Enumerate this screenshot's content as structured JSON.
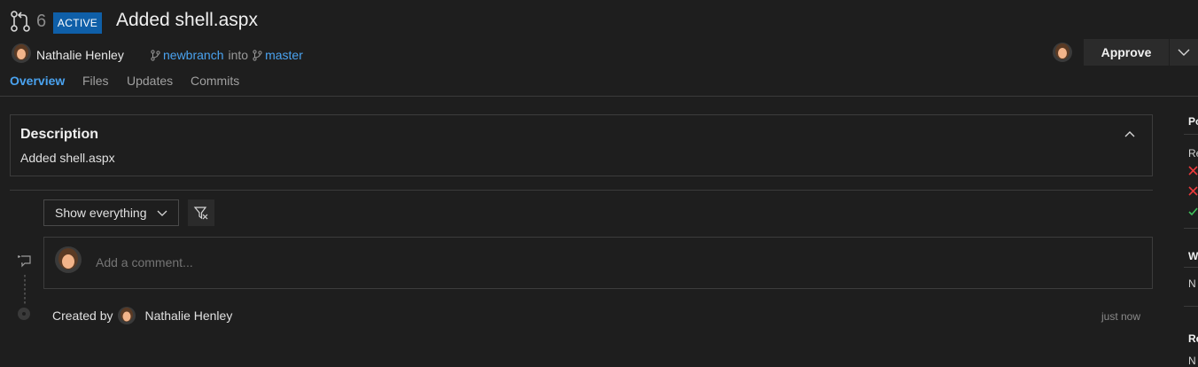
{
  "pr": {
    "id": "6",
    "status": "ACTIVE",
    "title": "Added shell.aspx",
    "author": "Nathalie Henley",
    "source_branch": "newbranch",
    "into_text": "into",
    "target_branch": "master"
  },
  "actions": {
    "approve_label": "Approve"
  },
  "tabs": [
    {
      "label": "Overview",
      "active": true
    },
    {
      "label": "Files",
      "active": false
    },
    {
      "label": "Updates",
      "active": false
    },
    {
      "label": "Commits",
      "active": false
    }
  ],
  "description": {
    "heading": "Description",
    "text": "Added shell.aspx"
  },
  "filter": {
    "selected": "Show everything"
  },
  "comment": {
    "placeholder": "Add a comment..."
  },
  "timeline": {
    "created_by_text": "Created by",
    "created_by_name": "Nathalie Henley",
    "time": "just now"
  },
  "sidebar": {
    "section1_label": "Po",
    "reviewers_label": "Re",
    "section2_label": "W",
    "section2_value": "N",
    "section3_label": "Re",
    "section3_value": "N"
  },
  "colors": {
    "accent": "#4aa3f0",
    "badge": "#0f5fa8",
    "reject": "#e8393b",
    "approve": "#3fbf5a",
    "background": "#1e1e1e"
  },
  "icons": {
    "pull_request": "pull-request-icon",
    "branch": "branch-icon",
    "collapse": "chevron-up-icon",
    "dropdown": "chevron-down-icon",
    "filter_clear": "filter-clear-icon",
    "comment": "comment-add-icon",
    "reject": "x-icon",
    "approved": "check-icon"
  }
}
